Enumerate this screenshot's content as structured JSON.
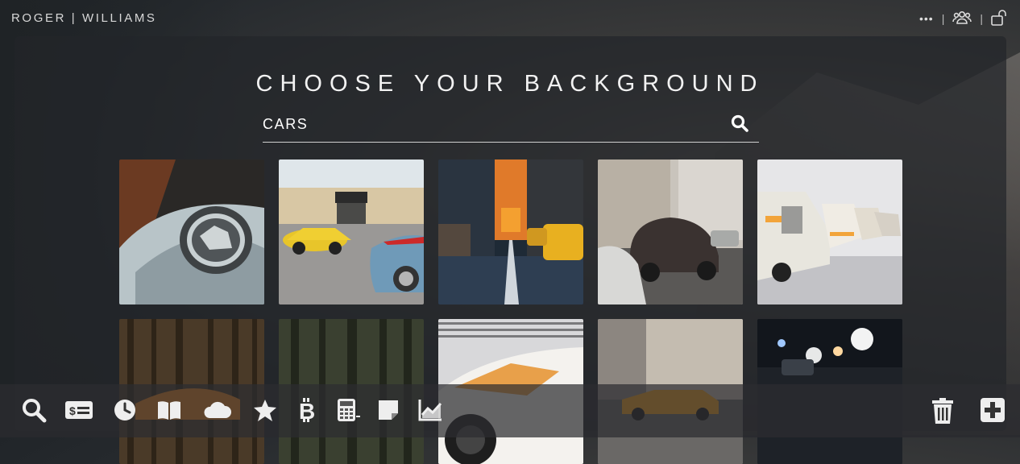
{
  "header": {
    "brand": "ROGER | WILLIAMS",
    "more_menu": "•••",
    "separator": "|"
  },
  "dialog": {
    "title": "CHOOSE YOUR BACKGROUND",
    "search": {
      "value": "CARS",
      "placeholder": ""
    }
  },
  "images": [
    {
      "subject": "Mustang emblem on grey car"
    },
    {
      "subject": "Yellow Ferrari and blue Porsche in lot"
    },
    {
      "subject": "City street at sunset with taxis"
    },
    {
      "subject": "Vintage Beetles on European street"
    },
    {
      "subject": "Row of classic white BMWs"
    },
    {
      "subject": "Orange car in forest"
    },
    {
      "subject": "Tall trees in forest"
    },
    {
      "subject": "White Lamborghini closeup"
    },
    {
      "subject": "Orange Lamborghini on city street"
    },
    {
      "subject": "Night traffic headlights"
    }
  ],
  "taskbar": {
    "icons": [
      "search-icon",
      "id-card-icon",
      "clock-icon",
      "book-icon",
      "cloud-icon",
      "star-icon",
      "bitcoin-icon",
      "calculator-icon",
      "sticky-note-icon",
      "chart-line-icon",
      "trash-icon",
      "plus-square-icon"
    ]
  },
  "colors": {
    "background": "#262a2e",
    "panel": "#22262a",
    "text": "#f2f2f2"
  }
}
